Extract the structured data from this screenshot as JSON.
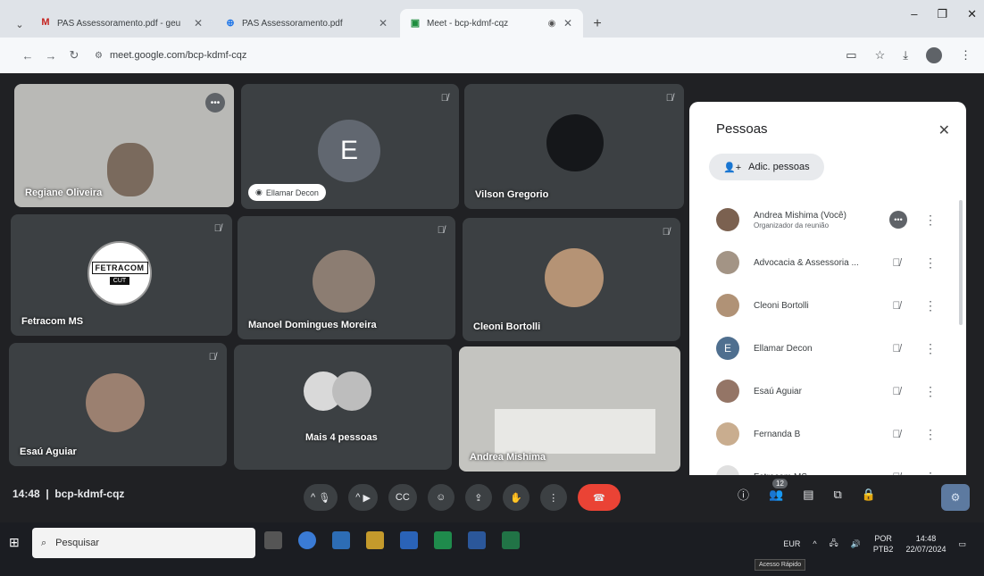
{
  "browser": {
    "tabs": [
      {
        "title": "PAS Assessoramento.pdf - geu",
        "favicon": "M",
        "active": false
      },
      {
        "title": "PAS Assessoramento.pdf",
        "favicon": "⊕",
        "active": false
      },
      {
        "title": "Meet - bcp-kdmf-cqz",
        "favicon": "▣",
        "active": true
      }
    ],
    "url": "meet.google.com/bcp-kdmf-cqz"
  },
  "tiles": [
    {
      "name": "Regiane Oliveira"
    },
    {
      "name": "Ellamar Decon",
      "initial": "E"
    },
    {
      "name": "Vilson Gregorio"
    },
    {
      "name": "Fetracom MS",
      "logo_brand": "FETRACOM",
      "logo_sub": "CUT"
    },
    {
      "name": "Manoel Domingues Moreira"
    },
    {
      "name": "Cleoni Bortolli"
    },
    {
      "name": "Esaú Aguiar"
    },
    {
      "name": "Mais 4 pessoas"
    },
    {
      "name": "Andrea Mishima"
    }
  ],
  "panel": {
    "title": "Pessoas",
    "add_label": "Adic. pessoas",
    "people": [
      {
        "name": "Andrea Mishima (Você)",
        "role": "Organizador da reunião"
      },
      {
        "name": "Advocacia & Assessoria ..."
      },
      {
        "name": "Cleoni Bortolli"
      },
      {
        "name": "Ellamar Decon",
        "initial": "E"
      },
      {
        "name": "Esaú Aguiar"
      },
      {
        "name": "Fernanda B"
      },
      {
        "name": "Fetracom MS"
      }
    ]
  },
  "meetbar": {
    "time": "14:48",
    "code": "bcp-kdmf-cqz",
    "participants_count": "12"
  },
  "taskbar": {
    "search_placeholder": "Pesquisar",
    "currency": "EUR",
    "lang": "POR",
    "lang2": "PTB2",
    "time": "14:48",
    "date": "22/07/2024",
    "tooltip": "Acesso Rápido"
  }
}
